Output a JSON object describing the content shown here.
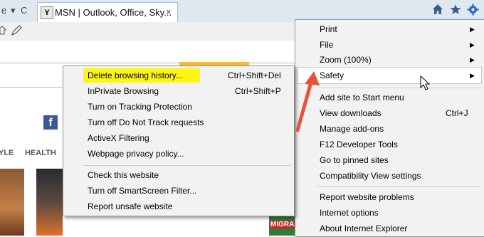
{
  "browser": {
    "nav": {
      "back": "e",
      "dropdown": "▾",
      "refresh": "C"
    },
    "tab": {
      "favicon": "Y",
      "title": "MSN | Outlook, Office, Sky...",
      "close": "×"
    },
    "icons": [
      "home-icon",
      "star-icon",
      "gear-icon"
    ],
    "cmd_icons": [
      "home-small-icon",
      "pen-icon"
    ]
  },
  "page": {
    "fb": "f",
    "nav_items": [
      "YLE",
      "HEALTH"
    ],
    "ad_text": "MIGRAI"
  },
  "tools_menu": {
    "items": [
      {
        "label": "Print",
        "submenu": true
      },
      {
        "label": "File",
        "submenu": true
      },
      {
        "label": "Zoom (100%)",
        "submenu": true
      },
      {
        "label": "Safety",
        "submenu": true
      },
      {
        "label": "Add site to Start menu"
      },
      {
        "label": "View downloads",
        "shortcut": "Ctrl+J"
      },
      {
        "label": "Manage add-ons"
      },
      {
        "label": "F12 Developer Tools"
      },
      {
        "label": "Go to pinned sites"
      },
      {
        "label": "Compatibility View settings"
      },
      {
        "label": "Report website problems"
      },
      {
        "label": "Internet options"
      },
      {
        "label": "About Internet Explorer"
      }
    ]
  },
  "safety_menu": {
    "items": [
      {
        "label": "Delete browsing history...",
        "shortcut": "Ctrl+Shift+Del"
      },
      {
        "label": "InPrivate Browsing",
        "shortcut": "Ctrl+Shift+P"
      },
      {
        "label": "Turn on Tracking Protection"
      },
      {
        "label": "Turn off Do Not Track requests"
      },
      {
        "label": "ActiveX Filtering"
      },
      {
        "label": "Webpage privacy policy..."
      },
      {
        "label": "Check this website"
      },
      {
        "label": "Turn off SmartScreen Filter..."
      },
      {
        "label": "Report unsafe website"
      }
    ]
  },
  "colors": {
    "highlight": "#fdf512",
    "annotation_arrow": "#e8523a"
  }
}
